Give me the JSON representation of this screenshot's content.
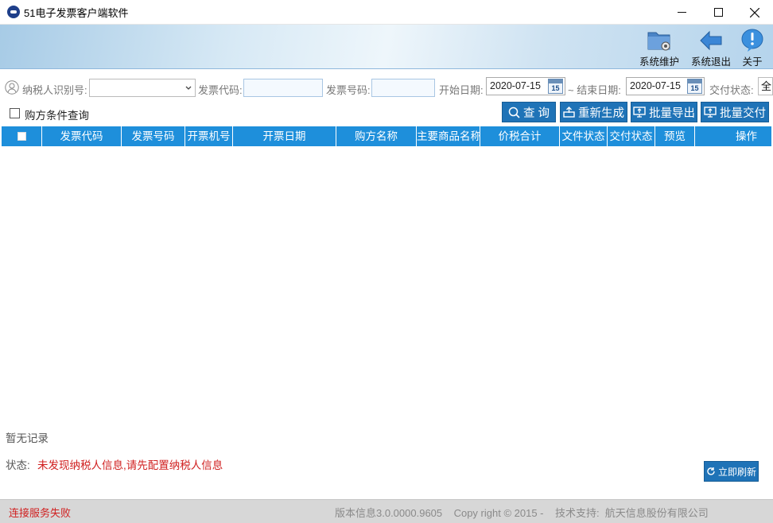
{
  "window": {
    "title": "51电子发票客户端软件",
    "logo_icon": "app-logo-icon",
    "controls": [
      "minimize-icon",
      "maximize-icon",
      "close-icon"
    ]
  },
  "banner": {
    "buttons": [
      {
        "label": "系统维护",
        "icon": "folder-gear-icon"
      },
      {
        "label": "系统退出",
        "icon": "arrow-left-icon"
      },
      {
        "label": "关于",
        "icon": "info-bubble-icon"
      }
    ]
  },
  "filters": {
    "taxpayer_id_label": "纳税人识别号:",
    "taxpayer_id_value": "",
    "invoice_code_label": "发票代码:",
    "invoice_code_value": "",
    "invoice_number_label": "发票号码:",
    "invoice_number_value": "",
    "start_date_label": "开始日期:",
    "start_date_value": "2020-07-15",
    "end_date_label": "~ 结束日期:",
    "end_date_value": "2020-07-15",
    "delivery_status_label": "交付状态:",
    "delivery_status_value": "全",
    "calendar_day": "15"
  },
  "buyer_condition": {
    "label": "购方条件查询",
    "checked": false
  },
  "actions": {
    "query": "查 询",
    "regenerate": "重新生成",
    "batch_export": "批量导出",
    "batch_deliver": "批量交付"
  },
  "grid": {
    "columns": [
      "发票代码",
      "发票号码",
      "开票机号",
      "开票日期",
      "购方名称",
      "主要商品名称",
      "价税合计",
      "文件状态",
      "交付状态",
      "预览",
      "操作"
    ],
    "rows": []
  },
  "empty_text": "暂无记录",
  "status": {
    "label": "状态:",
    "message": "未发现纳税人信息,请先配置纳税人信息"
  },
  "refresh_button": "立即刷新",
  "statusbar": {
    "connection": "连接服务失败",
    "info": "版本信息3.0.0000.9605    Copy right © 2015 -    技术支持:  航天信息股份有限公司"
  },
  "colors": {
    "accent": "#1f73b7",
    "grid_header": "#1e8fdb",
    "error": "#d02020"
  }
}
